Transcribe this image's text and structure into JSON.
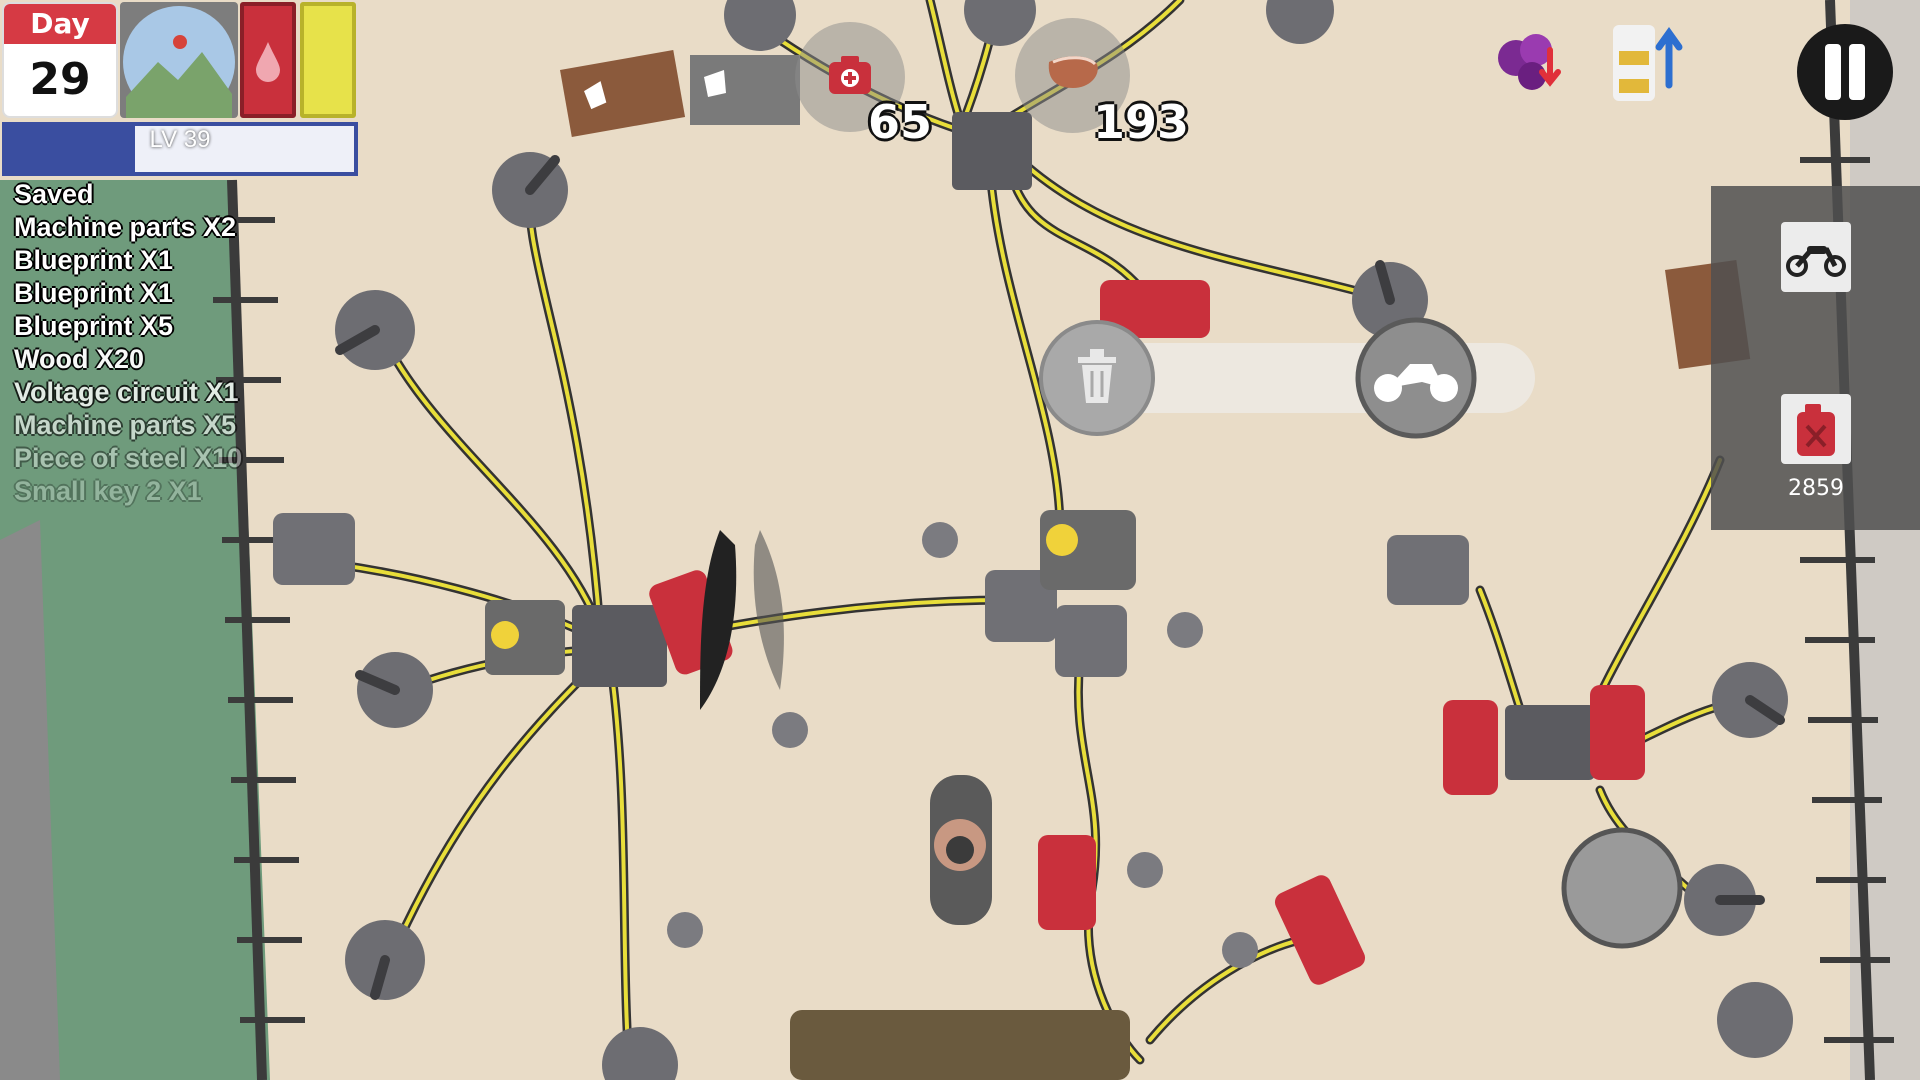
{
  "hud": {
    "day_label": "Day",
    "day_number": "29",
    "level_text": "LV 39",
    "level_progress": 0.37,
    "health_level": 0.95,
    "energy_level": 0.95
  },
  "resources": {
    "medkit_count": "65",
    "food_count": "193"
  },
  "log": [
    "Saved",
    "Machine parts X2",
    "Blueprint X1",
    "Blueprint X1",
    "Blueprint X5",
    "Wood X20",
    "Voltage circuit X1",
    "Machine parts X5",
    "Piece of steel X10",
    "Small key 2 X1"
  ],
  "side_panel": {
    "vehicle_slot_icon": "motorcycle-icon",
    "fuel_slot_icon": "fuel-can-icon",
    "fuel_count": "2859"
  },
  "colors": {
    "ground": "#e9dcc7",
    "cable": "#e8de3a",
    "generator_red": "#c9303c",
    "level_bar": "#3a4ea0",
    "day_header": "#d63a44"
  }
}
